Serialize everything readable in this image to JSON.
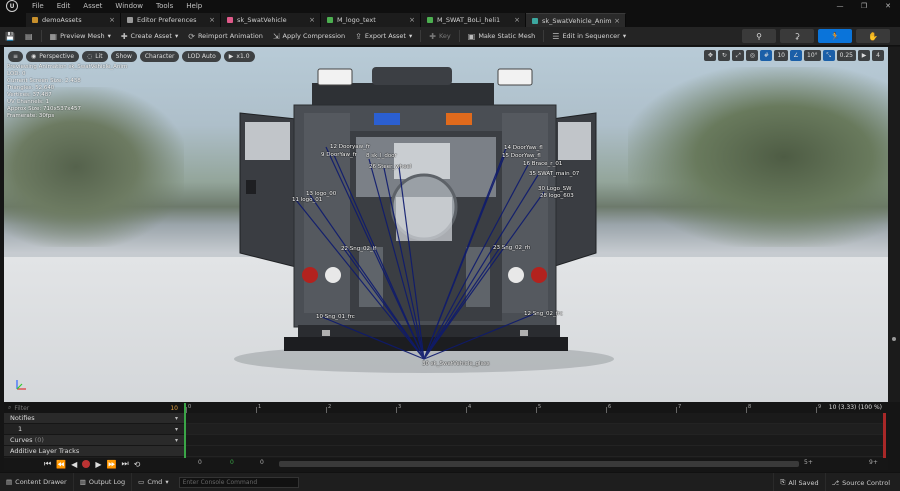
{
  "menu": [
    "File",
    "Edit",
    "Asset",
    "Window",
    "Tools",
    "Help"
  ],
  "tabs": [
    {
      "label": "demoAssets",
      "color": "#c8902c"
    },
    {
      "label": "Editor Preferences",
      "color": "#9a9a9a"
    },
    {
      "label": "sk_SwatVehicle",
      "color": "#e05a8a"
    },
    {
      "label": "M_logo_text",
      "color": "#4caf50"
    },
    {
      "label": "M_SWAT_BoLi_heli1",
      "color": "#4caf50"
    },
    {
      "label": "sk_SwatVehicle_Anim",
      "color": "#3ca8a0"
    }
  ],
  "toolbar": {
    "preview_mesh": "Preview Mesh",
    "create_asset": "Create Asset",
    "reimport": "Reimport Animation",
    "apply_compression": "Apply Compression",
    "export_asset": "Export Asset",
    "key": "Key",
    "make_static_mesh": "Make Static Mesh",
    "edit_in_sequencer": "Edit in Sequencer"
  },
  "viewport": {
    "perspective": "Perspective",
    "lit": "Lit",
    "show": "Show",
    "character": "Character",
    "lod": "LOD Auto",
    "speed": "x1.0",
    "grid_value": "10",
    "angle_value": "10°",
    "scale_value": "0.25",
    "cam_speed": "4"
  },
  "stats": [
    "Previewing Animation sk_SwatVehicle_Anim",
    "LOD: 0",
    "Current Screen Size: 2.438",
    "Triangles: 52,640",
    "Vertices: 37,487",
    "UV Channels: 1",
    "Approx Size: 710x537x457",
    "Framerate: 30fps"
  ],
  "bones": [
    {
      "label": "12 Dooryaw_fr"
    },
    {
      "label": "9 DoorYaw_fr"
    },
    {
      "label": "8 sk_l_door"
    },
    {
      "label": "26 Steer_wheel"
    },
    {
      "label": "13 logo_00"
    },
    {
      "label": "11 logo_01"
    },
    {
      "label": "22 Sng_02_lf"
    },
    {
      "label": "14 DoorYaw_fl"
    },
    {
      "label": "15 DoorYaw_fl"
    },
    {
      "label": "16 Brace_r_01"
    },
    {
      "label": "35 SWAT_main_07"
    },
    {
      "label": "30 Logo_SW"
    },
    {
      "label": "28 logo_603"
    },
    {
      "label": "23 Sng_02_rh"
    },
    {
      "label": "10 Sng_01_frc"
    },
    {
      "label": "12 Sng_02_frc"
    },
    {
      "label": "30 sk_SwatVehicle_glass"
    }
  ],
  "timeline": {
    "filter_placeholder": "Filter",
    "count": "10",
    "notifies": "Notifies",
    "track_1": "1",
    "curves": "Curves",
    "curves_count": "(0)",
    "additive": "Additive Layer Tracks",
    "frame_readout": "10 (3.33) (100 %)",
    "ticks": [
      "0",
      "1",
      "2",
      "3",
      "4",
      "5",
      "6",
      "7",
      "8",
      "9"
    ],
    "start_left": "0",
    "start_mid": "0",
    "start_right": "0",
    "end_a": "5+",
    "end_b": "9+"
  },
  "status": {
    "content_drawer": "Content Drawer",
    "output_log": "Output Log",
    "cmd": "Cmd",
    "console_placeholder": "Enter Console Command",
    "all_saved": "All Saved",
    "source_control": "Source Control"
  },
  "colors": {
    "accent": "#0a74da",
    "play_marker": "#3aa547",
    "end_marker": "#a82828"
  }
}
